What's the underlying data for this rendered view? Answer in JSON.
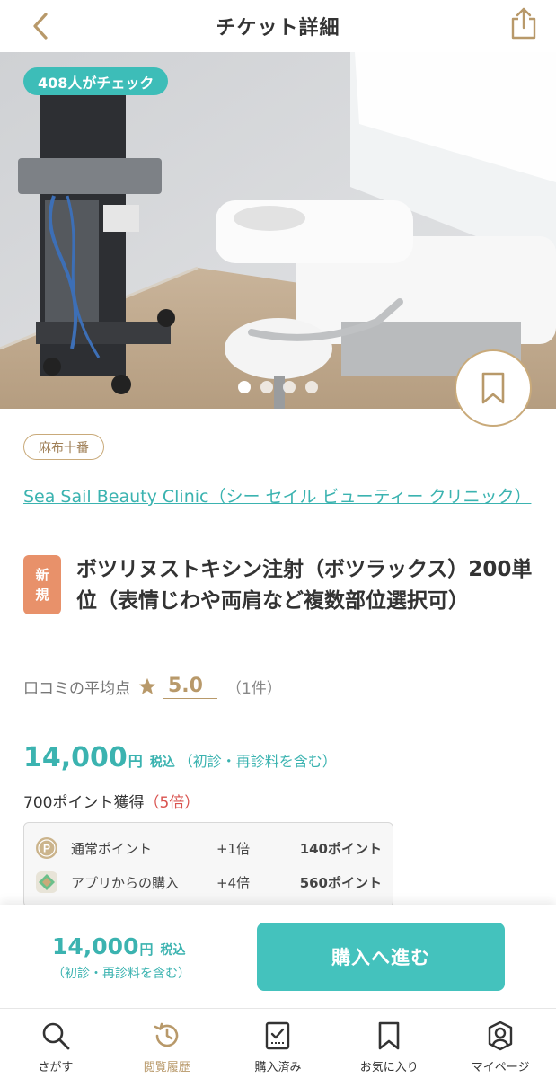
{
  "header": {
    "title": "チケット詳細",
    "back_icon": "chevron-left-icon",
    "share_icon": "share-icon"
  },
  "hero": {
    "checks_badge": "408人がチェック",
    "carousel_dots": 4,
    "active_dot": 0,
    "bookmark_icon": "bookmark-icon"
  },
  "clinic": {
    "area_tag": "麻布十番",
    "name": "Sea Sail Beauty Clinic（シー セイル ビューティー クリニック）"
  },
  "ticket": {
    "new_badge": "新規",
    "title": "ボツリヌストキシン注射（ボツラックス）200単位（表情じわや両肩など複数部位選択可）"
  },
  "rating": {
    "label": "口コミの平均点",
    "score": "5.0",
    "count": "（1件）"
  },
  "price": {
    "amount": "14,000",
    "yen": "円",
    "tax": "税込",
    "note": "（初診・再診料を含む）"
  },
  "points": {
    "earned": "700ポイント獲得",
    "multiplier": "（5倍）",
    "rows": [
      {
        "icon": "point-coin-icon",
        "label": "通常ポイント",
        "rate": "+1倍",
        "amount": "140ポイント"
      },
      {
        "icon": "app-icon",
        "label": "アプリからの購入",
        "rate": "+4倍",
        "amount": "560ポイント"
      }
    ]
  },
  "purchase_bar": {
    "amount": "14,000",
    "yen": "円",
    "tax": "税込",
    "note": "（初診・再診料を含む）",
    "button_label": "購入へ進む"
  },
  "bottom_nav": {
    "items": [
      {
        "label": "さがす",
        "icon": "search-icon"
      },
      {
        "label": "閲覧履歴",
        "icon": "history-icon"
      },
      {
        "label": "購入済み",
        "icon": "purchased-icon"
      },
      {
        "label": "お気に入り",
        "icon": "bookmark-icon"
      },
      {
        "label": "マイページ",
        "icon": "user-icon"
      }
    ],
    "active_index": 1
  },
  "colors": {
    "teal": "#3bb3b0",
    "gold": "#b8996a",
    "new_badge": "#e8916a",
    "multiplier": "#d9534f"
  }
}
